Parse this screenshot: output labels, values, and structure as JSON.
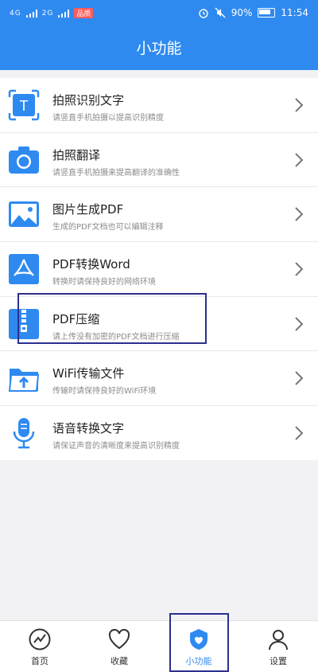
{
  "status": {
    "network_1": "4G",
    "network_2": "2G",
    "badge": "品质",
    "battery_percent": "90%",
    "time": "11:54"
  },
  "header": {
    "title": "小功能"
  },
  "features": [
    {
      "title": "拍照识别文字",
      "subtitle": "请竖直手机拍摄以提高识别精度",
      "icon": "text-scan-icon"
    },
    {
      "title": "拍照翻译",
      "subtitle": "请竖直手机拍摄来提高翻译的准确性",
      "icon": "camera-icon"
    },
    {
      "title": "图片生成PDF",
      "subtitle": "生成的PDF文档也可以编辑注释",
      "icon": "image-icon"
    },
    {
      "title": "PDF转换Word",
      "subtitle": "转换时请保持良好的网络环境",
      "icon": "pdf-icon"
    },
    {
      "title": "PDF压缩",
      "subtitle": "请上传没有加密的PDF文档进行压缩",
      "icon": "zip-icon"
    },
    {
      "title": "WiFi传输文件",
      "subtitle": "传输时请保持良好的WiFi环境",
      "icon": "folder-upload-icon"
    },
    {
      "title": "语音转换文字",
      "subtitle": "请保证声音的清晰度来提高识别精度",
      "icon": "microphone-icon"
    }
  ],
  "tabs": [
    {
      "label": "首页",
      "icon": "home-icon"
    },
    {
      "label": "收藏",
      "icon": "heart-icon"
    },
    {
      "label": "小功能",
      "icon": "shield-icon",
      "active": true
    },
    {
      "label": "设置",
      "icon": "user-icon"
    }
  ],
  "colors": {
    "primary": "#2f8af0",
    "highlight_box": "#2c2f8e"
  }
}
